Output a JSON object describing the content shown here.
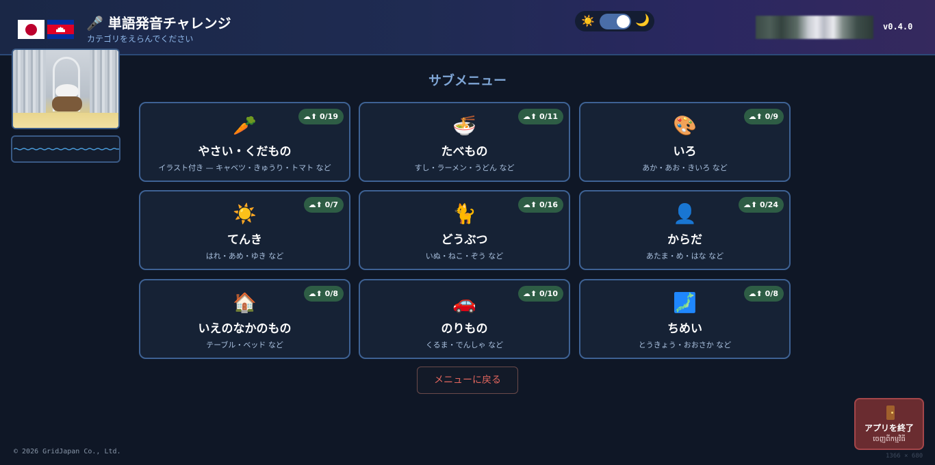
{
  "header": {
    "title_icon": "🎤",
    "title": "単語発音チャレンジ",
    "subtitle": "カテゴリをえらんでください",
    "version": "v0.4.0",
    "flags": [
      "japan-flag",
      "cambodia-flag"
    ]
  },
  "theme_toggle": {
    "sun_icon": "☀️",
    "moon_icon": "🌙",
    "mode": "dark"
  },
  "main": {
    "section_title": "サブメニュー",
    "categories": [
      {
        "emoji": "🥕",
        "label": "やさい・くだもの",
        "examples": "イラスト付き — キャベツ・きゅうり・トマト など",
        "progress": "0/19",
        "done": 0,
        "total": 19
      },
      {
        "emoji": "🍜",
        "label": "たべもの",
        "examples": "すし・ラーメン・うどん など",
        "progress": "0/11",
        "done": 0,
        "total": 11
      },
      {
        "emoji": "🎨",
        "label": "いろ",
        "examples": "あか・あお・きいろ など",
        "progress": "0/9",
        "done": 0,
        "total": 9
      },
      {
        "emoji": "☀️",
        "label": "てんき",
        "examples": "はれ・あめ・ゆき など",
        "progress": "0/7",
        "done": 0,
        "total": 7
      },
      {
        "emoji": "🐈",
        "label": "どうぶつ",
        "examples": "いぬ・ねこ・ぞう など",
        "progress": "0/16",
        "done": 0,
        "total": 16
      },
      {
        "emoji": "👤",
        "label": "からだ",
        "examples": "あたま・め・はな など",
        "progress": "0/24",
        "done": 0,
        "total": 24
      },
      {
        "emoji": "🏠",
        "label": "いえのなかのもの",
        "examples": "テーブル・ベッド など",
        "progress": "0/8",
        "done": 0,
        "total": 8
      },
      {
        "emoji": "🚗",
        "label": "のりもの",
        "examples": "くるま・でんしゃ など",
        "progress": "0/10",
        "done": 0,
        "total": 10
      },
      {
        "emoji": "🗾",
        "label": "ちめい",
        "examples": "とうきょう・おおさか など",
        "progress": "0/8",
        "done": 0,
        "total": 8
      }
    ],
    "badge_icon": "☁⬆",
    "back_button": "メニューに戻る"
  },
  "footer": {
    "copyright": "© 2026 GridJapan Co., Ltd.",
    "exit_label": "アプリを終了",
    "exit_sub": "ចេញពីកម្មវិធី",
    "resolution": "1366 × 680"
  },
  "colors": {
    "background": "#0f1726",
    "card_border": "#3e6294",
    "badge_bg": "#2e5d45",
    "back_text": "#e2665e",
    "exit_bg": "#6a2c30"
  }
}
